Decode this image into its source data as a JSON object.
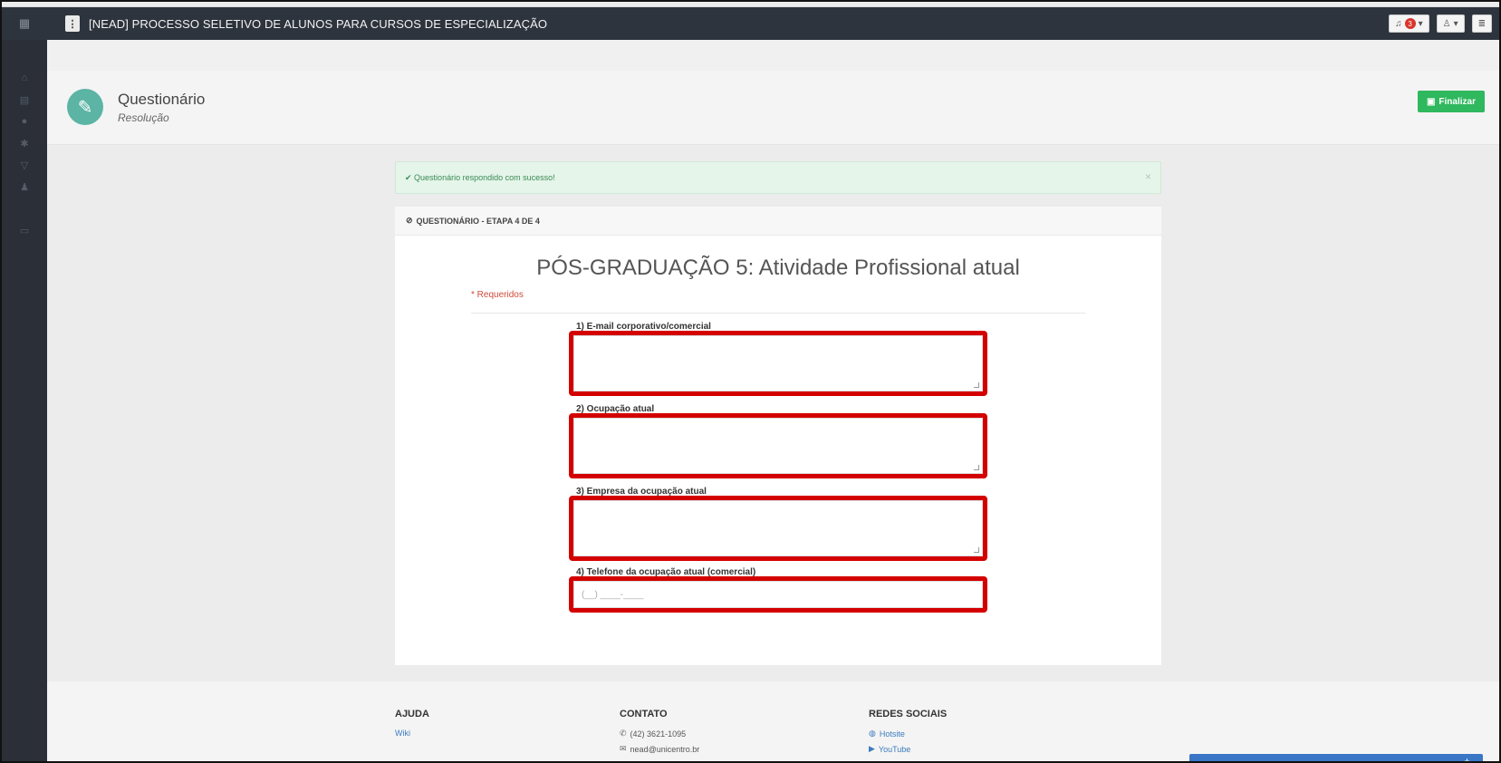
{
  "topbar": {
    "title": "[NEAD] PROCESSO SELETIVO DE ALUNOS PARA CURSOS DE ESPECIALIZAÇÃO",
    "notifications_count": "3"
  },
  "page_header": {
    "title": "Questionário",
    "subtitle": "Resolução",
    "finalize_label": "Finalizar"
  },
  "alert": {
    "message": "Questionário respondido com sucesso!"
  },
  "card": {
    "header": "QUESTIONÁRIO - ETAPA 4 DE 4",
    "title": "PÓS-GRADUAÇÃO 5: Atividade Profissional atual",
    "required_note": "* Requeridos",
    "fields": [
      {
        "label": "1) E-mail corporativo/comercial",
        "value": ""
      },
      {
        "label": "2) Ocupação atual",
        "value": ""
      },
      {
        "label": "3) Empresa da ocupação atual",
        "value": ""
      },
      {
        "label": "4) Telefone da ocupação atual (comercial)",
        "placeholder": "(__) ____-____"
      }
    ]
  },
  "footer": {
    "help": {
      "heading": "AJUDA",
      "items": [
        "Wiki"
      ]
    },
    "contact": {
      "heading": "CONTATO",
      "items": [
        "(42) 3621-1095",
        "nead@unicentro.br"
      ]
    },
    "social": {
      "heading": "REDES SOCIAIS",
      "items": [
        "Hotsite",
        "YouTube"
      ]
    }
  },
  "colors": {
    "highlight": "#d40000",
    "success": "#2fb85d",
    "topbar": "#2e343d"
  }
}
